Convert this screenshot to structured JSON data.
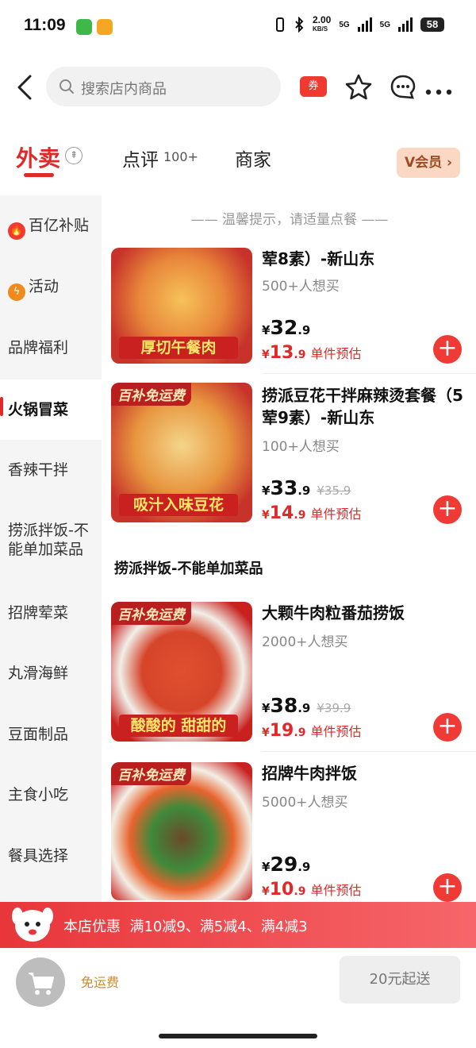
{
  "status_bar": {
    "time": "11:09",
    "net_speed_value": "2.00",
    "net_speed_unit": "KB/S",
    "net1": "5G",
    "net2": "5G",
    "battery": "58"
  },
  "header": {
    "search_placeholder": "搜索店内商品",
    "coupon_label": "券"
  },
  "tabs": {
    "takeout": "外卖",
    "reviews": "点评",
    "reviews_count": "100+",
    "merchant": "商家",
    "vip": "会员",
    "vip_prefix": "V"
  },
  "sidebar": {
    "items": [
      {
        "label": "百亿补贴",
        "icon": "flame-icon"
      },
      {
        "label": "活动",
        "icon": "lightning-icon"
      },
      {
        "label": "品牌福利"
      },
      {
        "label": "火锅冒菜"
      },
      {
        "label": "香辣干拌"
      },
      {
        "label": "捞派拌饭-不能单加菜品"
      },
      {
        "label": "招牌荤菜"
      },
      {
        "label": "丸滑海鲜"
      },
      {
        "label": "豆面制品"
      },
      {
        "label": "主食小吃"
      },
      {
        "label": "餐具选择"
      }
    ],
    "active_index": 3
  },
  "main": {
    "tip": "—— 温馨提示，请适量点餐 ——",
    "section_title": "捞派拌饭-不能单加菜品",
    "products": [
      {
        "name": "荤8素）-新山东",
        "want": "500+人想买",
        "price_int": "32",
        "price_dec": ".9",
        "orig_price": "",
        "sub_price_int": "13",
        "sub_price_dec": ".9",
        "sub_label": "单件预估",
        "image_banner": "厚切午餐肉",
        "image_tag": ""
      },
      {
        "name": "捞派豆花干拌麻辣烫套餐（5荤9素）-新山东",
        "want": "100+人想买",
        "price_int": "33",
        "price_dec": ".9",
        "orig_price": "¥35.9",
        "sub_price_int": "14",
        "sub_price_dec": ".9",
        "sub_label": "单件预估",
        "image_banner": "吸汁入味豆花",
        "image_tag": "百补免运费"
      },
      {
        "name": "大颗牛肉粒番茄捞饭",
        "want": "2000+人想买",
        "price_int": "38",
        "price_dec": ".9",
        "orig_price": "¥39.9",
        "sub_price_int": "19",
        "sub_price_dec": ".9",
        "sub_label": "单件预估",
        "image_banner": "酸酸的 甜甜的",
        "image_tag": "百补免运费"
      },
      {
        "name": "招牌牛肉拌饭",
        "want": "5000+人想买",
        "price_int": "29",
        "price_dec": ".9",
        "orig_price": "",
        "sub_price_int": "10",
        "sub_price_dec": ".9",
        "sub_label": "单件预估",
        "image_banner": "",
        "image_tag": "百补免运费"
      }
    ],
    "currency": "¥"
  },
  "promo": {
    "label": "本店优惠",
    "text": "满10减9、满5减4、满4减3"
  },
  "bottom_bar": {
    "free_shipping": "免运费",
    "min_order": "20元起送"
  },
  "colors": {
    "accent": "#e02a2a",
    "add_button": "#ef3a35",
    "promo_bar": "#e8363a",
    "vip_bg": "#fbd8c4"
  }
}
